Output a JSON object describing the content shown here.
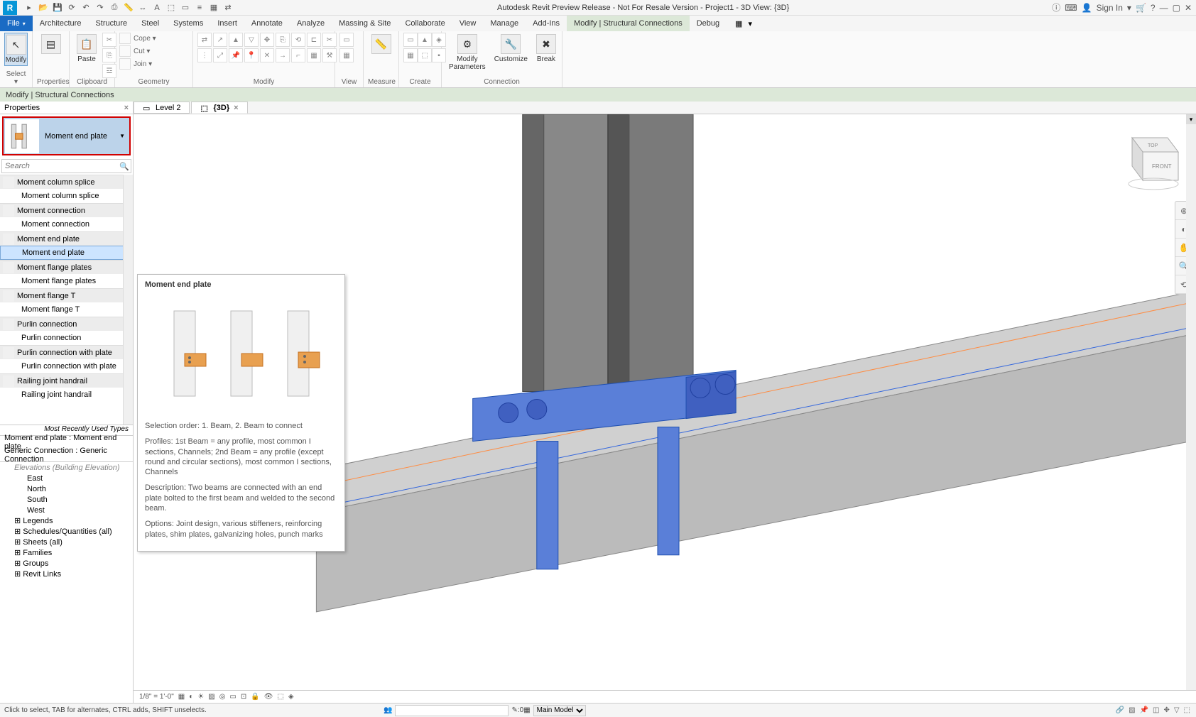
{
  "title": "Autodesk Revit Preview Release - Not For Resale Version - Project1 - 3D View: {3D}",
  "signin": "Sign In",
  "ribbonTabs": [
    "Architecture",
    "Structure",
    "Steel",
    "Systems",
    "Insert",
    "Annotate",
    "Analyze",
    "Massing & Site",
    "Collaborate",
    "View",
    "Manage",
    "Add-Ins",
    "Modify | Structural Connections",
    "Debug"
  ],
  "activeTab": "Modify | Structural Connections",
  "fileLabel": "File",
  "panels": {
    "select": "Select ▾",
    "properties": "Properties",
    "clipboard": "Clipboard",
    "geometry": "Geometry",
    "modify": "Modify",
    "modify_btn": "Modify",
    "view": "View",
    "measure": "Measure",
    "create": "Create",
    "connection": "Connection",
    "conn_modify": "Modify\nParameters",
    "conn_customize": "Customize",
    "conn_break": "Break",
    "paste": "Paste",
    "cope": "Cope ▾",
    "cut": "Cut ▾",
    "join": "Join ▾"
  },
  "contextBar": "Modify | Structural Connections",
  "propsTab": "Properties",
  "typeSelector": "Moment end plate",
  "searchPlaceholder": "Search",
  "categories": [
    {
      "name": "Moment column splice",
      "items": [
        "Moment column splice"
      ]
    },
    {
      "name": "Moment connection",
      "items": [
        "Moment connection"
      ]
    },
    {
      "name": "Moment end plate",
      "items": [
        "Moment end plate"
      ],
      "selected": true
    },
    {
      "name": "Moment flange plates",
      "items": [
        "Moment flange plates"
      ]
    },
    {
      "name": "Moment flange T",
      "items": [
        "Moment flange T"
      ]
    },
    {
      "name": "Purlin connection",
      "items": [
        "Purlin connection"
      ]
    },
    {
      "name": "Purlin connection with plate",
      "items": [
        "Purlin connection with plate"
      ]
    },
    {
      "name": "Railing joint handrail",
      "items": [
        "Railing joint handrail"
      ]
    }
  ],
  "recentHeader": "Most Recently Used Types",
  "recent": [
    "Moment end plate : Moment end plate",
    "Generic Connection : Generic Connection"
  ],
  "browserNodes": [
    "East",
    "North",
    "South",
    "West"
  ],
  "browserTop": [
    "Legends",
    "Schedules/Quantities (all)",
    "Sheets (all)",
    "Families",
    "Groups",
    "Revit Links"
  ],
  "viewTabs": [
    {
      "label": "Level 2",
      "active": false
    },
    {
      "label": "{3D}",
      "active": true
    }
  ],
  "viewScale": "1/8\" = 1'-0\"",
  "tooltip": {
    "title": "Moment end plate",
    "order": "Selection order: 1. Beam, 2. Beam to connect",
    "profiles": "Profiles: 1st Beam = any profile, most common I sections, Channels; 2nd Beam = any profile (except round and circular sections), most common I sections, Channels",
    "desc": "Description: Two beams are connected with an end plate bolted to the first beam and welded to the second beam.",
    "options": "Options: Joint design, various stiffeners, reinforcing plates, shim plates, galvanizing holes, punch marks"
  },
  "status": {
    "msg": "Click to select, TAB for alternates, CTRL adds, SHIFT unselects.",
    "coord": ":0",
    "model": "Main Model"
  },
  "viewcube": {
    "top": "TOP",
    "front": "FRONT"
  }
}
